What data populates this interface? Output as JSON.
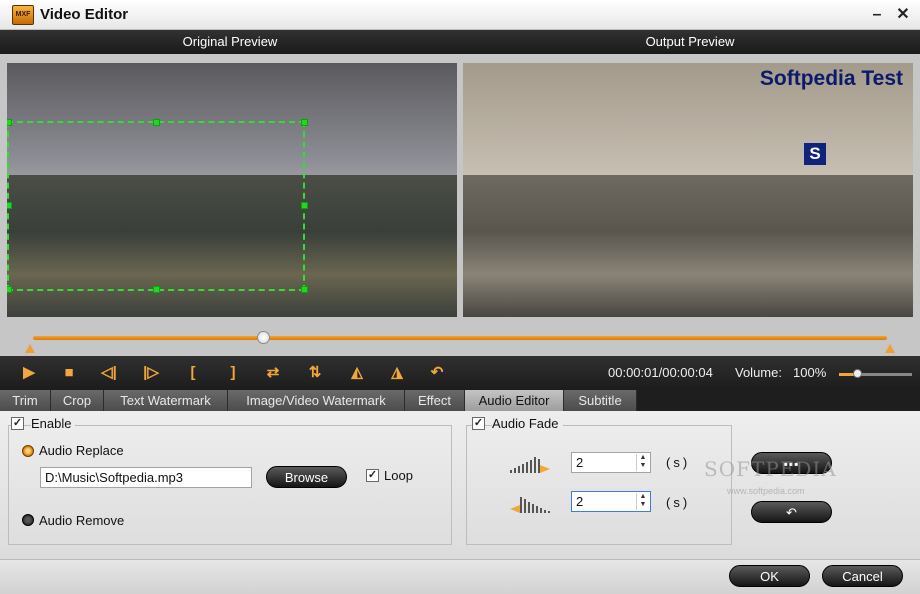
{
  "window": {
    "title": "Video Editor",
    "icon_text": "MXF"
  },
  "preview": {
    "original_label": "Original Preview",
    "output_label": "Output Preview",
    "watermark_text": "Softpedia Test",
    "watermark_logo": "S"
  },
  "timeline": {
    "position_fraction": 0.27
  },
  "toolbar": {
    "time": "00:00:01/00:00:04",
    "volume_label": "Volume:",
    "volume_value": "100%",
    "volume_fraction": 0.2
  },
  "tabs": [
    {
      "label": "Trim",
      "active": false
    },
    {
      "label": "Crop",
      "active": false
    },
    {
      "label": "Text Watermark",
      "active": false
    },
    {
      "label": "Image/Video Watermark",
      "active": false
    },
    {
      "label": "Effect",
      "active": false
    },
    {
      "label": "Audio Editor",
      "active": true
    },
    {
      "label": "Subtitle",
      "active": false
    }
  ],
  "audio": {
    "enable_label": "Enable",
    "enable_checked": true,
    "replace_label": "Audio Replace",
    "file_path": "D:\\Music\\Softpedia.mp3",
    "browse_label": "Browse",
    "loop_label": "Loop",
    "loop_checked": true,
    "remove_label": "Audio Remove",
    "fade_label": "Audio Fade",
    "fade_checked": true,
    "fade_in_value": "2",
    "fade_out_value": "2",
    "unit": "(s)"
  },
  "watermark": {
    "text": "SOFTPEDIA",
    "small": "www.softpedia.com"
  },
  "footer": {
    "ok_label": "OK",
    "cancel_label": "Cancel"
  },
  "colors": {
    "accent": "#f2a73b",
    "crop_border": "#33dd33",
    "watermark_text": "#0b1a6b"
  }
}
